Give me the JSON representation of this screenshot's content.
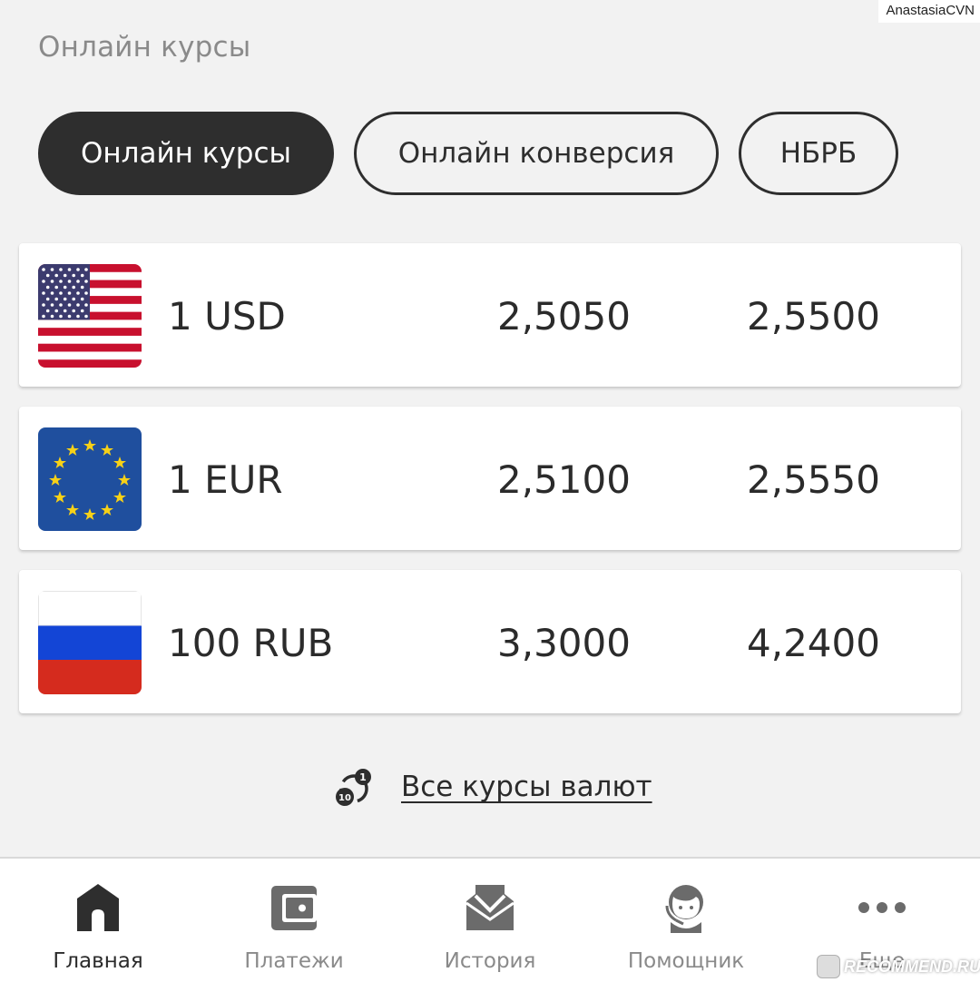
{
  "watermark_top": "AnastasiaCVN",
  "section_title": "Онлайн курсы",
  "tabs": [
    {
      "label": "Онлайн курсы",
      "active": true
    },
    {
      "label": "Онлайн конверсия",
      "active": false
    },
    {
      "label": "НБРБ",
      "active": false
    }
  ],
  "rates": [
    {
      "flag": "us-flag-icon",
      "currency": "1 USD",
      "buy": "2,5050",
      "sell": "2,5500"
    },
    {
      "flag": "eu-flag-icon",
      "currency": "1 EUR",
      "buy": "2,5100",
      "sell": "2,5550"
    },
    {
      "flag": "ru-flag-icon",
      "currency": "100 RUB",
      "buy": "3,3000",
      "sell": "4,2400"
    }
  ],
  "coins_badges": [
    "1",
    "10"
  ],
  "all_rates_link": "Все курсы валют",
  "nav": [
    {
      "label": "Главная",
      "icon": "home-icon",
      "active": true
    },
    {
      "label": "Платежи",
      "icon": "wallet-icon",
      "active": false
    },
    {
      "label": "История",
      "icon": "envelope-icon",
      "active": false
    },
    {
      "label": "Помощник",
      "icon": "assistant-icon",
      "active": false
    },
    {
      "label": "Еще",
      "icon": "more-icon",
      "active": false
    }
  ],
  "watermark_bottom": "RECOMMEND.RU",
  "colors": {
    "background": "#f2f2f2",
    "card": "#ffffff",
    "dark": "#2e2e2e",
    "muted_text": "#8a8a8a"
  }
}
